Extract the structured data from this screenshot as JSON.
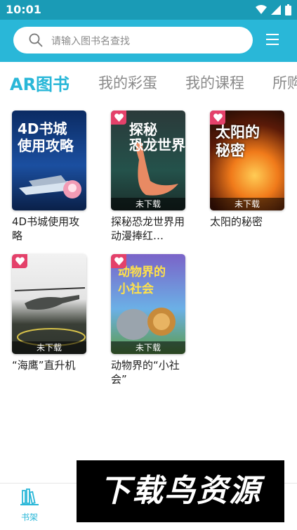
{
  "status": {
    "time": "10:01"
  },
  "search": {
    "placeholder": "请输入图书名查找"
  },
  "tabs": [
    {
      "label": "AR图书",
      "active": true
    },
    {
      "label": "我的彩蛋",
      "active": false
    },
    {
      "label": "我的课程",
      "active": false
    },
    {
      "label": "所购",
      "active": false
    }
  ],
  "books": [
    {
      "title": "4D书城使用攻略",
      "cover_text": "4D书城\n使用攻略",
      "status": "",
      "favorite": false
    },
    {
      "title": "探秘恐龙世界用动漫捧红…",
      "cover_text": "探秘\n恐龙世界",
      "status": "未下载",
      "favorite": true
    },
    {
      "title": "太阳的秘密",
      "cover_text": "太阳的\n秘密",
      "status": "未下载",
      "favorite": true
    },
    {
      "title": "“海鹰”直升机",
      "cover_text": "",
      "status": "未下载",
      "favorite": true
    },
    {
      "title": "动物界的“小社会”",
      "cover_text": "动物界的\n小社会",
      "status": "未下载",
      "favorite": true
    }
  ],
  "bottom_nav": {
    "bookshelf_label": "书架"
  },
  "watermark": "下载鸟资源",
  "colors": {
    "accent": "#29b7d8",
    "status_bar": "#1a9bb6",
    "heart": "#e4416a"
  }
}
